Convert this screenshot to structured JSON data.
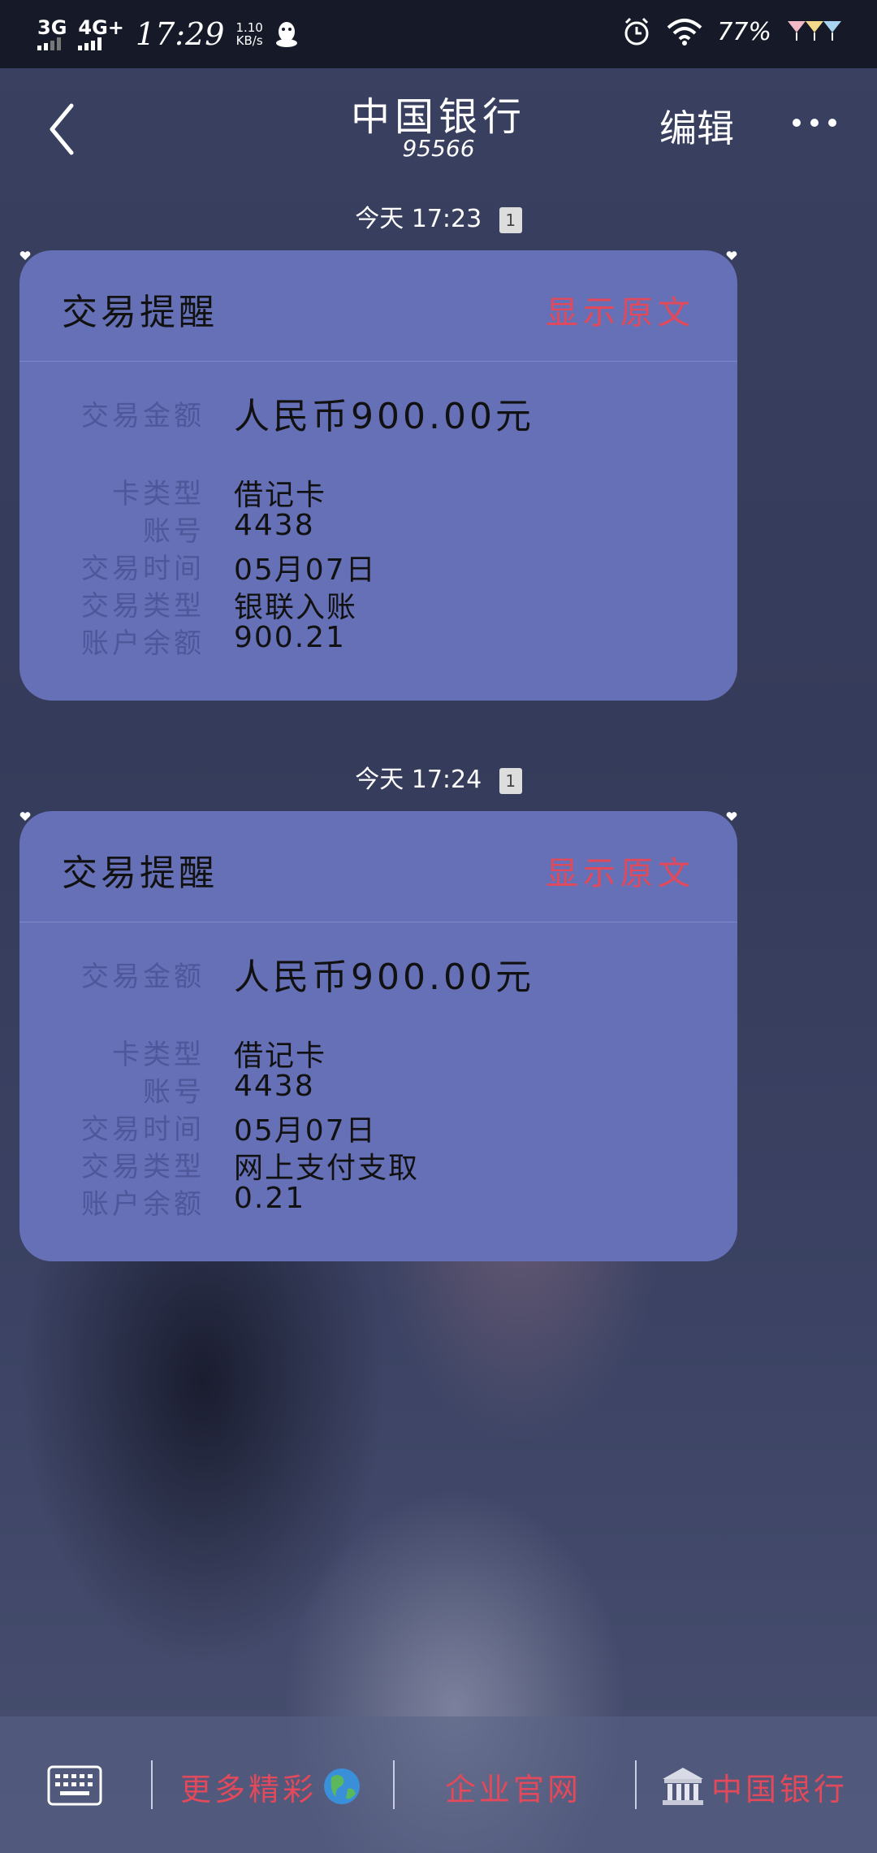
{
  "status_bar": {
    "network_1": "3G",
    "network_2": "4G+",
    "time": "17:29",
    "speed_value": "1.10",
    "speed_unit": "KB/s",
    "battery": "77%"
  },
  "header": {
    "title": "中国银行",
    "subtitle": "95566",
    "edit_label": "编辑"
  },
  "messages": [
    {
      "timestamp": "今天 17:23",
      "sim": "1",
      "title": "交易提醒",
      "show_original": "显示原文",
      "fields": [
        {
          "label": "交易金额",
          "value": "人民币900.00元"
        },
        {
          "label": "卡类型",
          "value": "借记卡"
        },
        {
          "label": "账号",
          "value": "4438"
        },
        {
          "label": "交易时间",
          "value": "05月07日"
        },
        {
          "label": "交易类型",
          "value": "银联入账"
        },
        {
          "label": "账户余额",
          "value": "900.21"
        }
      ]
    },
    {
      "timestamp": "今天 17:24",
      "sim": "1",
      "title": "交易提醒",
      "show_original": "显示原文",
      "fields": [
        {
          "label": "交易金额",
          "value": "人民币900.00元"
        },
        {
          "label": "卡类型",
          "value": "借记卡"
        },
        {
          "label": "账号",
          "value": "4438"
        },
        {
          "label": "交易时间",
          "value": "05月07日"
        },
        {
          "label": "交易类型",
          "value": "网上支付支取"
        },
        {
          "label": "账户余额",
          "value": "0.21"
        }
      ]
    }
  ],
  "bottom_menu": {
    "item_1": "更多精彩",
    "item_2": "企业官网",
    "item_3": "中国银行"
  },
  "colors": {
    "card_bg": "#6570b6",
    "accent_red": "#e2495a",
    "label_muted": "#4e5799"
  }
}
